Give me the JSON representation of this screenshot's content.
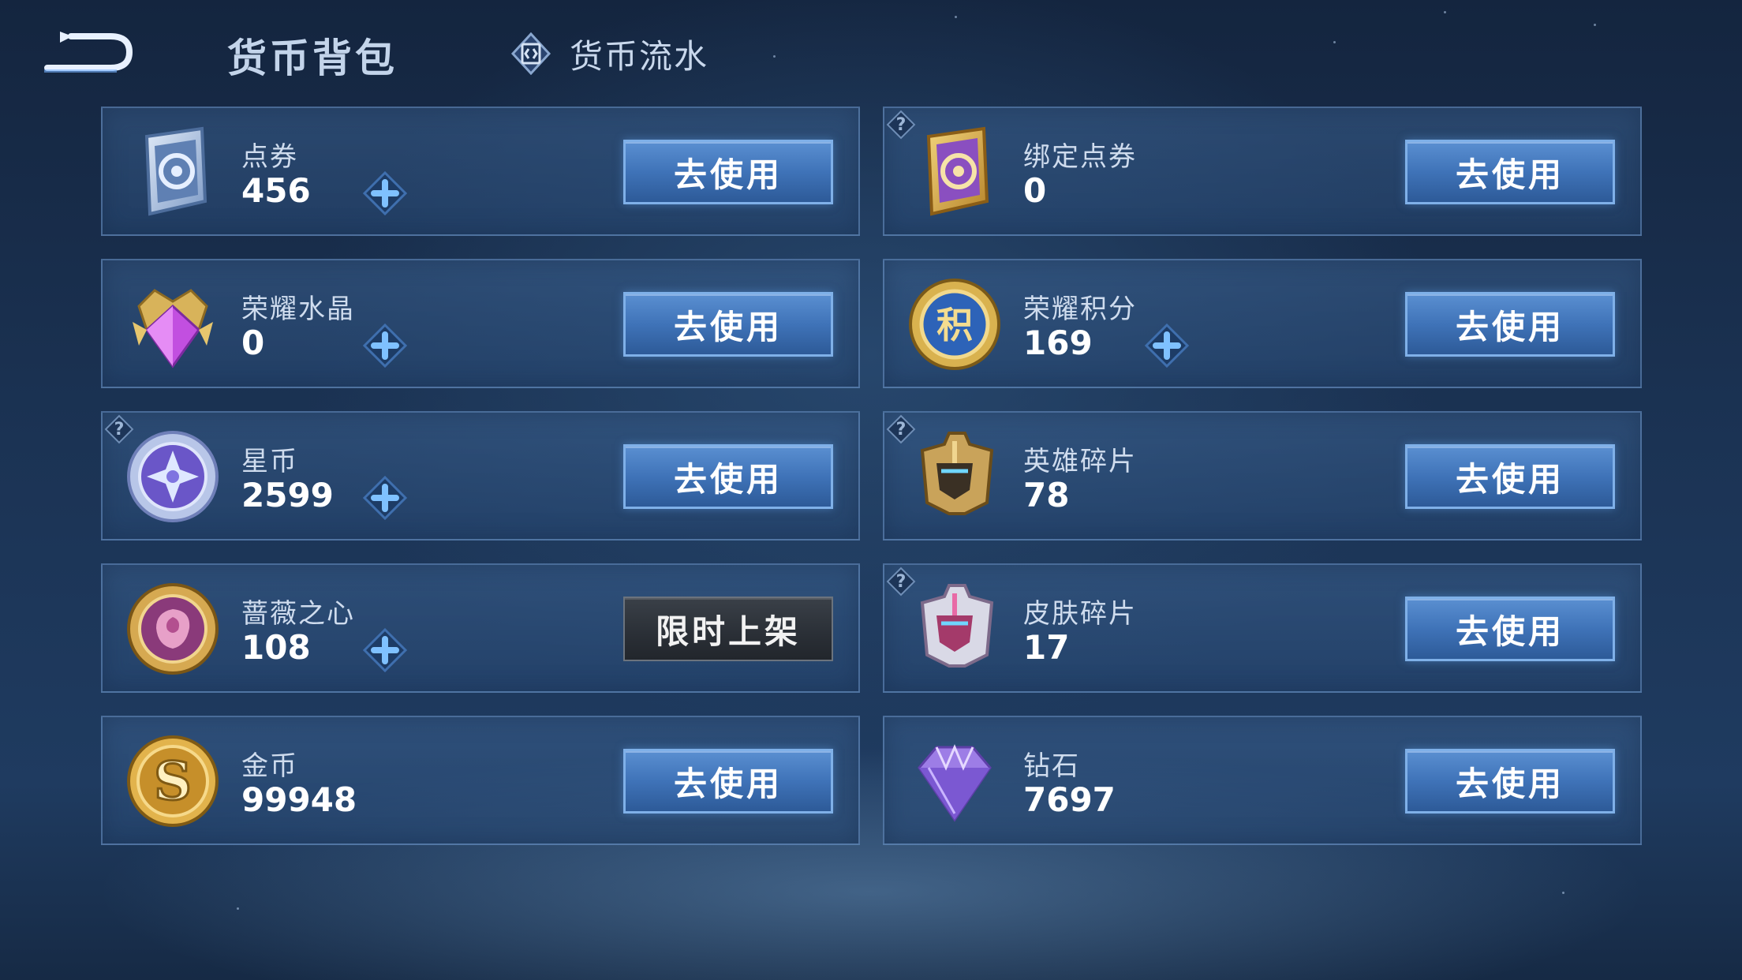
{
  "header": {
    "title": "货币背包",
    "ledger_tab": "货币流水"
  },
  "accent_colors": {
    "button_blue": "#3f73b8",
    "button_disabled": "#2a2f36",
    "plus_blue": "#5ea8f0"
  },
  "currencies": [
    {
      "name": "点券",
      "amount": "456",
      "icon": "voucher-ticket-icon",
      "has_plus": true,
      "has_help": false,
      "button": "去使用"
    },
    {
      "name": "绑定点券",
      "amount": "0",
      "icon": "bound-voucher-icon",
      "has_plus": false,
      "has_help": true,
      "button": "去使用"
    },
    {
      "name": "荣耀水晶",
      "amount": "0",
      "icon": "glory-crystal-icon",
      "has_plus": true,
      "has_help": false,
      "button": "去使用"
    },
    {
      "name": "荣耀积分",
      "amount": "169",
      "icon": "glory-points-icon",
      "has_plus": true,
      "has_help": false,
      "button": "去使用"
    },
    {
      "name": "星币",
      "amount": "2599",
      "icon": "star-coin-icon",
      "has_plus": true,
      "has_help": true,
      "button": "去使用"
    },
    {
      "name": "英雄碎片",
      "amount": "78",
      "icon": "hero-fragment-icon",
      "has_plus": false,
      "has_help": true,
      "button": "去使用"
    },
    {
      "name": "蔷薇之心",
      "amount": "108",
      "icon": "rose-heart-icon",
      "has_plus": true,
      "has_help": false,
      "button": "限时上架"
    },
    {
      "name": "皮肤碎片",
      "amount": "17",
      "icon": "skin-fragment-icon",
      "has_plus": false,
      "has_help": true,
      "button": "去使用"
    },
    {
      "name": "金币",
      "amount": "99948",
      "icon": "gold-coin-icon",
      "has_plus": false,
      "has_help": false,
      "button": "去使用"
    },
    {
      "name": "钻石",
      "amount": "7697",
      "icon": "diamond-icon",
      "has_plus": false,
      "has_help": false,
      "button": "去使用"
    }
  ],
  "help_mark": "?"
}
